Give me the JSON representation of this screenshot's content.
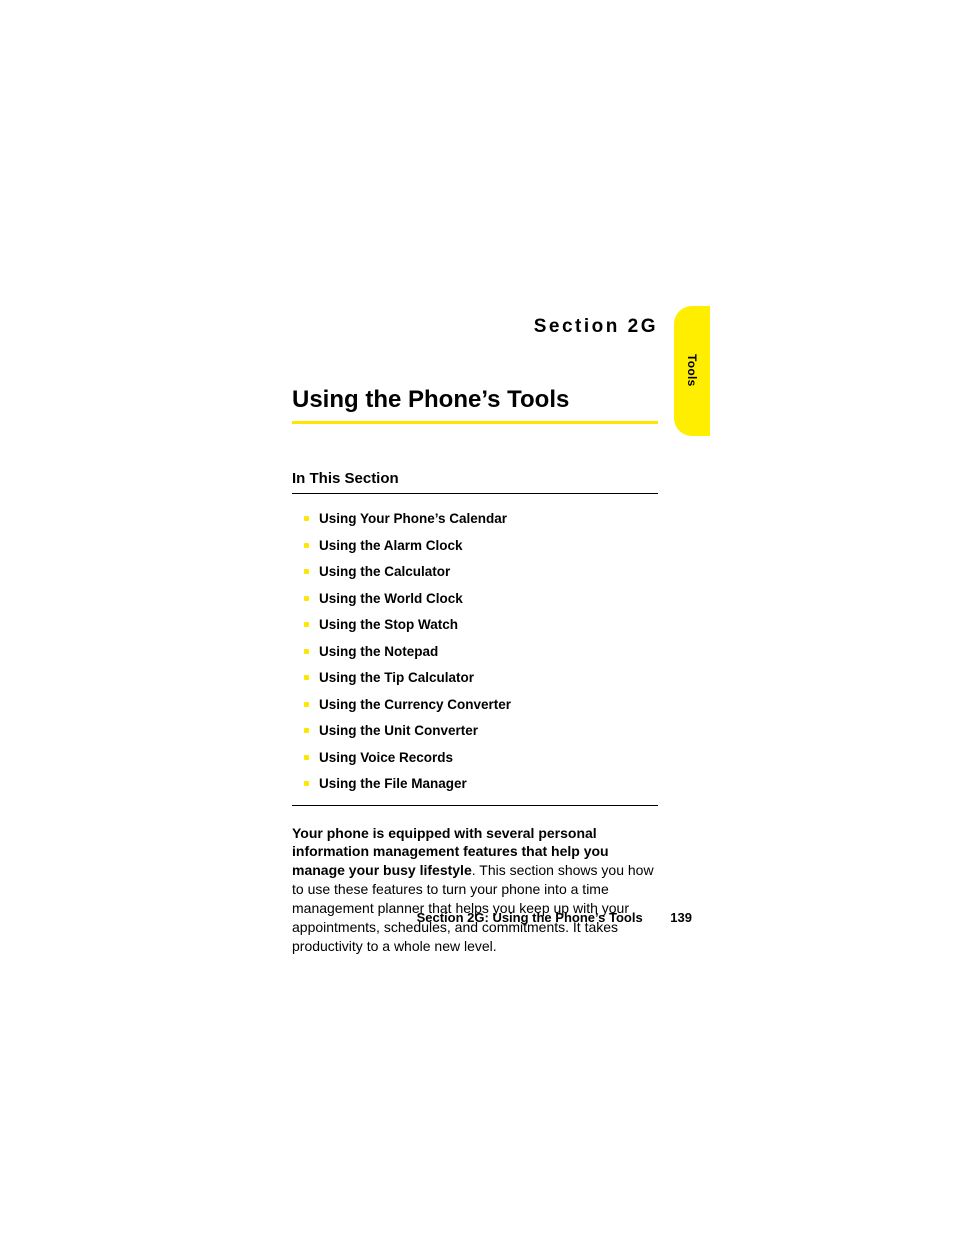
{
  "section_label": "Section 2G",
  "title": "Using the Phone’s Tools",
  "tab_label": "Tools",
  "subhead": "In This Section",
  "toc": [
    "Using Your Phone’s Calendar",
    "Using the Alarm Clock",
    "Using the Calculator",
    "Using the World Clock",
    "Using the Stop Watch",
    "Using the Notepad",
    "Using the Tip Calculator",
    "Using the Currency Converter",
    "Using the Unit Converter",
    "Using Voice Records",
    "Using the File Manager"
  ],
  "para_bold": "Your phone is equipped with several personal information management features that help you manage your busy lifestyle",
  "para_rest": ". This section shows you how to use these features to turn your phone into a time management planner that helps you keep up with your appointments, schedules, and commitments. It takes productivity to a whole new level.",
  "footer_title": "Section 2G: Using the Phone’s Tools",
  "page_number": "139"
}
